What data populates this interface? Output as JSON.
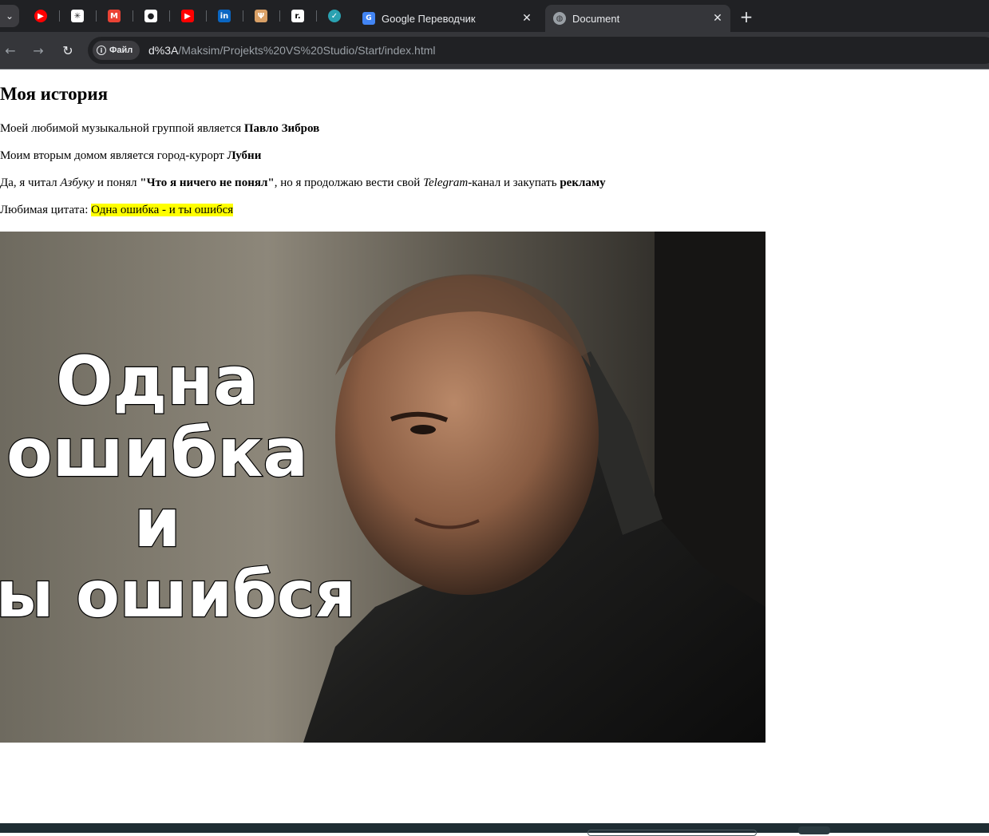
{
  "browser": {
    "pinned_tabs": [
      {
        "name": "youtube-music",
        "icon": "play-circle-icon",
        "color": "#ff0000",
        "glyph": "▶"
      },
      {
        "name": "chatgpt",
        "icon": "openai-knot-icon",
        "color": "#ffffff",
        "glyph": "✳"
      },
      {
        "name": "gmail",
        "icon": "gmail-icon",
        "color": "#ea4335",
        "glyph": "M"
      },
      {
        "name": "github",
        "icon": "github-icon",
        "color": "#ffffff",
        "glyph": "●"
      },
      {
        "name": "youtube",
        "icon": "youtube-icon",
        "color": "#ff0000",
        "glyph": "▶"
      },
      {
        "name": "linkedin",
        "icon": "linkedin-icon",
        "color": "#0a66c2",
        "glyph": "in"
      },
      {
        "name": "deer-app",
        "icon": "deer-icon",
        "color": "#d9a066",
        "glyph": "Ψ"
      },
      {
        "name": "r-app",
        "icon": "r-letter-icon",
        "color": "#000000",
        "glyph": "r."
      },
      {
        "name": "checkmark-app",
        "icon": "checkmark-icon",
        "color": "#2aa1b1",
        "glyph": "✓"
      }
    ],
    "tabs": [
      {
        "label": "Google Переводчик",
        "icon": "google-translate-icon",
        "active": false
      },
      {
        "label": "Document",
        "icon": "globe-icon",
        "active": true
      }
    ],
    "new_tab_glyph": "+",
    "close_glyph": "✕",
    "nav": {
      "back_glyph": "←",
      "forward_glyph": "→",
      "reload_glyph": "↻"
    },
    "address": {
      "chip_label": "Файл",
      "host": "d%3A",
      "path": "/Maksim/Projekts%20VS%20Studio/Start/index.html"
    }
  },
  "page": {
    "heading": "Моя история",
    "p1": {
      "text": "Моей любимой музыкальной группой является ",
      "bold": "Павло Зибров"
    },
    "p2": {
      "text": "Моим вторым домом является город-курорт ",
      "bold": "Лубни"
    },
    "p3": {
      "t1": "Да, я читал ",
      "i1": "Азбуку",
      "t2": " и понял ",
      "b1": "\"Что я ничего не понял\"",
      "t3": ", но я продолжаю вести свой ",
      "i2": "Telegram",
      "t4": "-канал и закупать ",
      "b2": "рекламу"
    },
    "p4": {
      "label": "Любимая цитата: ",
      "quote": "Одна ошибка - и ты ошибся",
      "highlight_color": "#ffff00"
    },
    "image": {
      "caption_lines": [
        "Одна",
        "ошибка",
        "и",
        "ты ошибся"
      ]
    }
  }
}
